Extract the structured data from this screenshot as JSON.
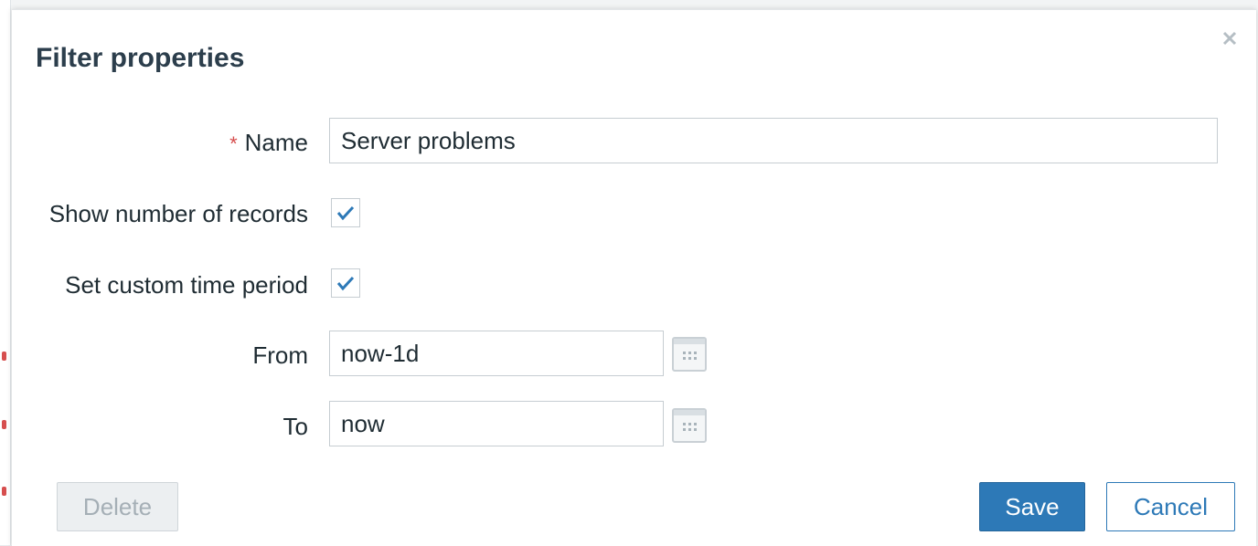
{
  "dialog": {
    "title": "Filter properties",
    "close_icon": "close-icon"
  },
  "form": {
    "name": {
      "required_mark": "*",
      "label": "Name",
      "value": "Server problems"
    },
    "show_number_of_records": {
      "label": "Show number of records",
      "checked": true
    },
    "set_custom_time_period": {
      "label": "Set custom time period",
      "checked": true
    },
    "from": {
      "label": "From",
      "value": "now-1d",
      "picker_icon": "calendar-icon"
    },
    "to": {
      "label": "To",
      "value": "now",
      "picker_icon": "calendar-icon"
    }
  },
  "buttons": {
    "delete": "Delete",
    "save": "Save",
    "cancel": "Cancel"
  },
  "colors": {
    "primary": "#2d79b7",
    "required": "#d64e4e",
    "checkmark": "#2d79b7"
  }
}
